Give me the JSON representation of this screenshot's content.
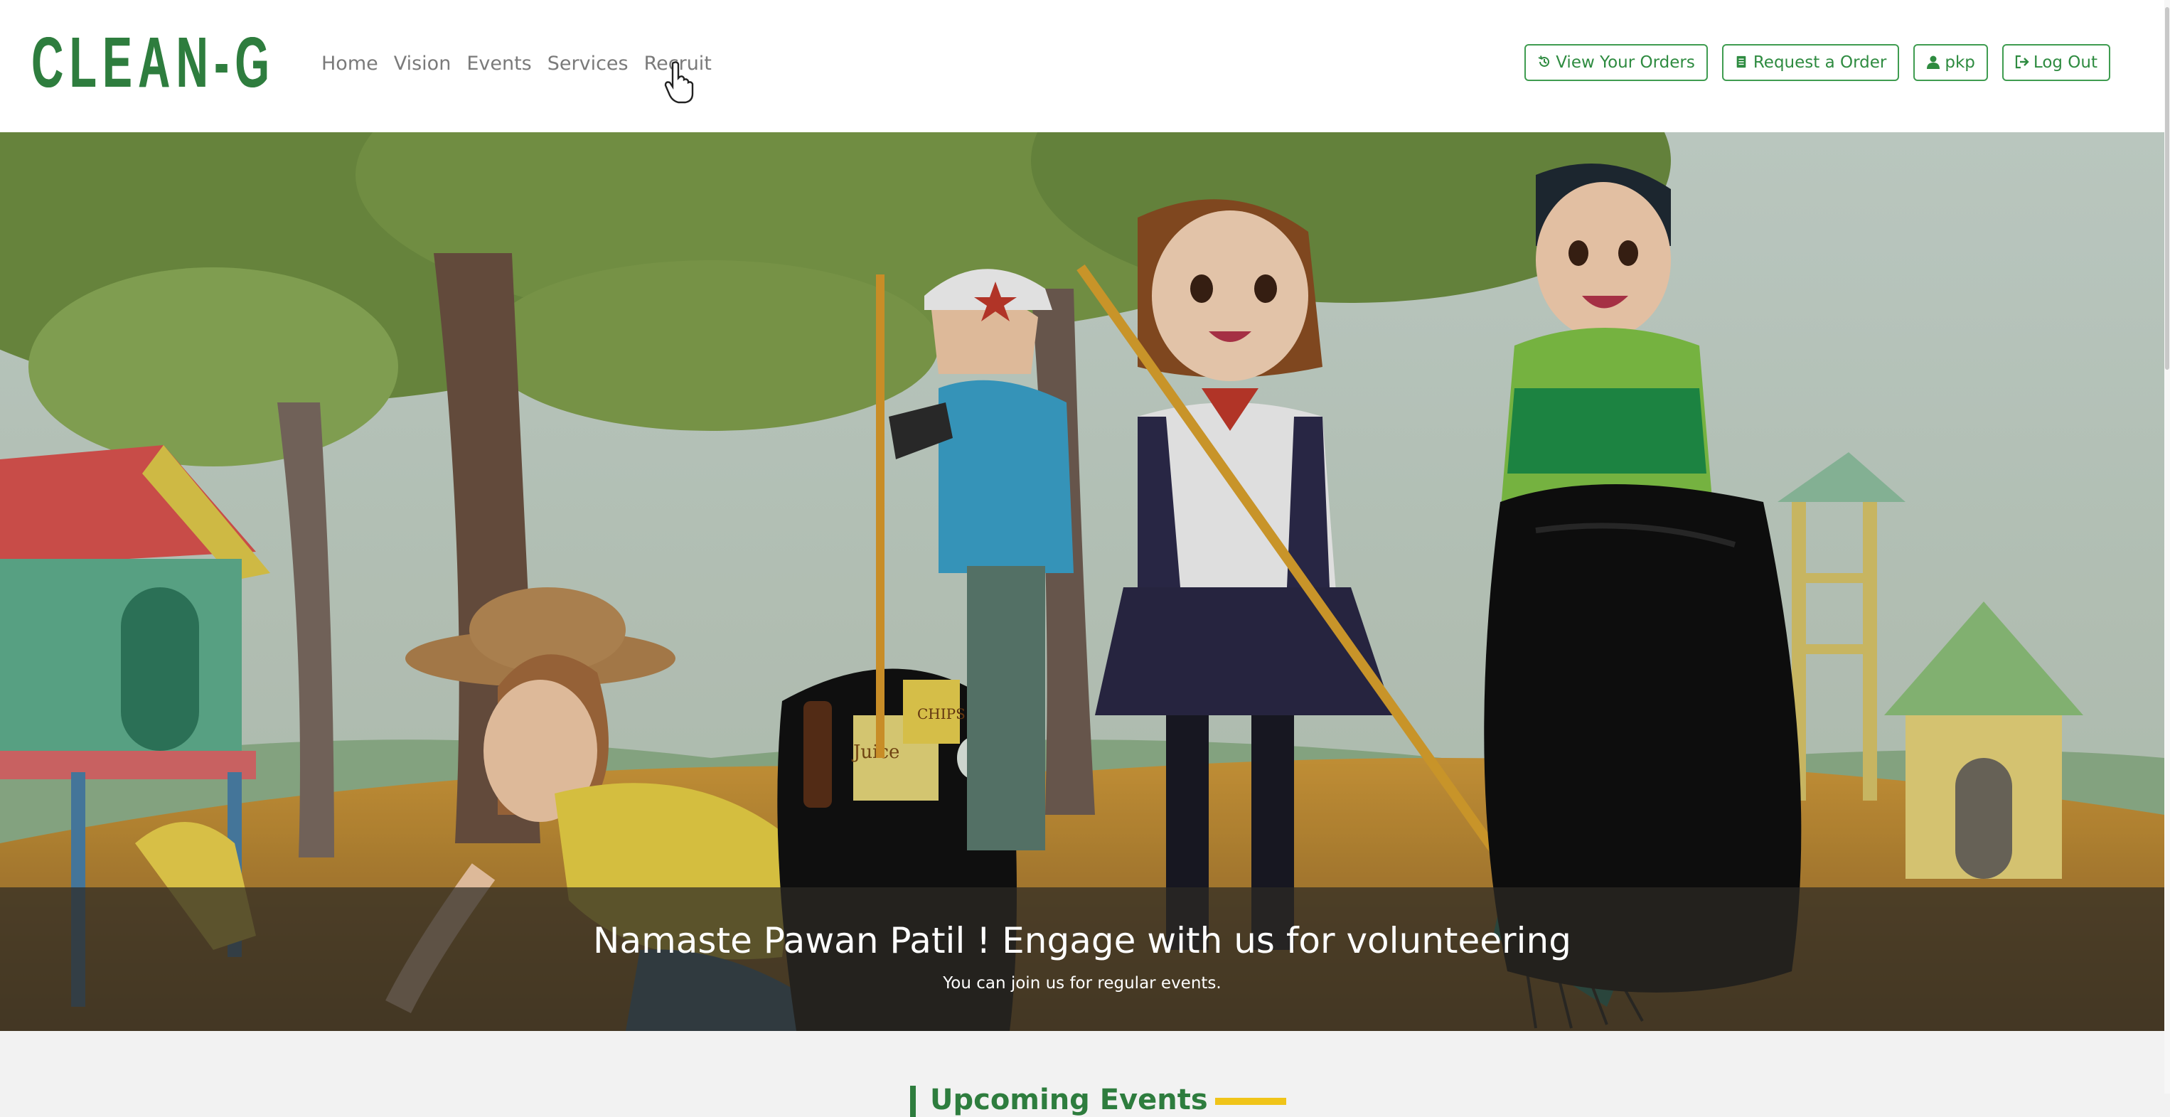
{
  "brand": {
    "logo_text": "CLEAN-G",
    "accent": "#2e7d3e"
  },
  "nav": {
    "links": [
      "Home",
      "Vision",
      "Events",
      "Services",
      "Recruit"
    ],
    "hovered": "Recruit"
  },
  "actions": [
    {
      "label": "View Your Orders",
      "icon": "history-icon"
    },
    {
      "label": "Request a Order",
      "icon": "document-icon"
    },
    {
      "label": "pkp",
      "icon": "user-icon"
    },
    {
      "label": "Log Out",
      "icon": "logout-icon"
    }
  ],
  "hero": {
    "title": "Namaste Pawan Patil ! Engage with us for volunteering",
    "subtitle": "You can join us for regular events.",
    "image_labels": {
      "juice": "Juice",
      "chips": "CHIPS"
    }
  },
  "section": {
    "heading": "Upcoming Events"
  },
  "colors": {
    "button_border": "#3f9c50",
    "caption_bg": "#2d2a24",
    "highlight": "#f0c419"
  }
}
